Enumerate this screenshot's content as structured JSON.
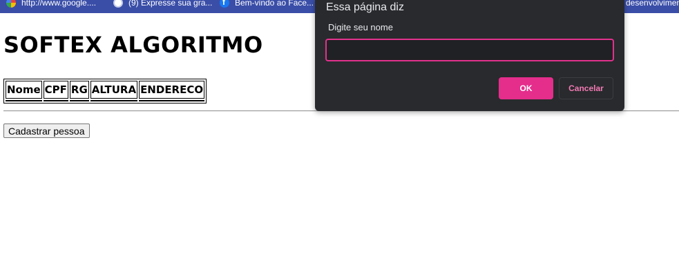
{
  "bookmarks": [
    {
      "label": "http://www.google....",
      "icon": "google-icon"
    },
    {
      "label": "(9) Expresse sua gra...",
      "icon": "globe-icon"
    },
    {
      "label": "Bem-vindo ao Face...",
      "icon": "facebook-icon"
    },
    {
      "label": "desenvolvimen",
      "icon": ""
    }
  ],
  "page": {
    "title": "SOFTEX ALGORITMO",
    "table_headers": [
      "Nome",
      "CPF",
      "RG",
      "ALTURA",
      "ENDERECO"
    ],
    "register_button": "Cadastrar pessoa"
  },
  "dialog": {
    "title": "Essa página diz",
    "message": "Digite seu nome",
    "input_value": "",
    "ok_label": "OK",
    "cancel_label": "Cancelar"
  },
  "colors": {
    "bookmarks_bar": "#3a4ea8",
    "dialog_bg": "#292a2d",
    "accent": "#e52d8c"
  }
}
